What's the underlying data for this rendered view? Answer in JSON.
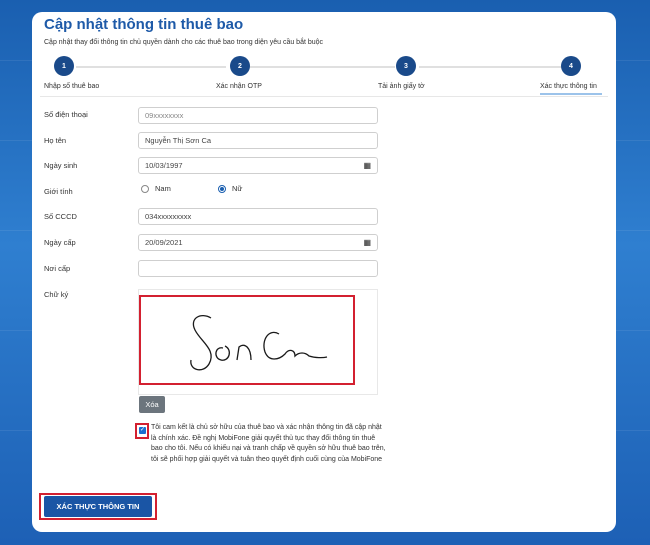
{
  "header": {
    "title": "Cập nhật thông tin thuê bao",
    "subtitle": "Cập nhật thay đổi thông tin chủ quyền dành cho các thuê bao trong diện yêu cầu bắt buộc"
  },
  "steps": [
    {
      "number": "1",
      "label": "Nhập số thuê bao"
    },
    {
      "number": "2",
      "label": "Xác nhận OTP"
    },
    {
      "number": "3",
      "label": "Tải ảnh giấy tờ"
    },
    {
      "number": "4",
      "label": "Xác thực thông tin"
    }
  ],
  "form": {
    "phone": {
      "label": "Số điện thoại",
      "value": "09xxxxxxxx"
    },
    "name": {
      "label": "Họ tên",
      "value": "Nguyễn Thị Sơn Ca"
    },
    "dob": {
      "label": "Ngày sinh",
      "value": "10/03/1997"
    },
    "gender": {
      "label": "Giới tính",
      "options": [
        "Nam",
        "Nữ"
      ],
      "selected": "Nữ"
    },
    "cccd": {
      "label": "Số CCCD",
      "value": "034xxxxxxxxx"
    },
    "issue_date": {
      "label": "Ngày cấp",
      "value": "20/09/2021"
    },
    "issue_place": {
      "label": "Nơi cấp",
      "value": ""
    },
    "signature": {
      "label": "Chữ ký"
    },
    "clear_label": "Xóa",
    "commitment": "Tôi cam kết là chủ sở hữu của thuê bao và xác nhận thông tin đã cập nhật là chính xác. Đề nghị MobiFone giải quyết thủ tục thay đổi thông tin thuê bao cho tôi. Nếu có khiếu nại và tranh chấp về quyền sở hữu thuê bao trên, tôi sẽ phối hợp giải quyết và tuân theo quyết định cuối cùng của MobiFone",
    "submit_label": "XÁC THỰC THÔNG TIN"
  },
  "colors": {
    "primary": "#1a55a5",
    "highlight": "#d32030",
    "step": "#1a4a8a"
  },
  "icons": {
    "calendar": "calendar-icon",
    "check": "checkmark-icon"
  }
}
